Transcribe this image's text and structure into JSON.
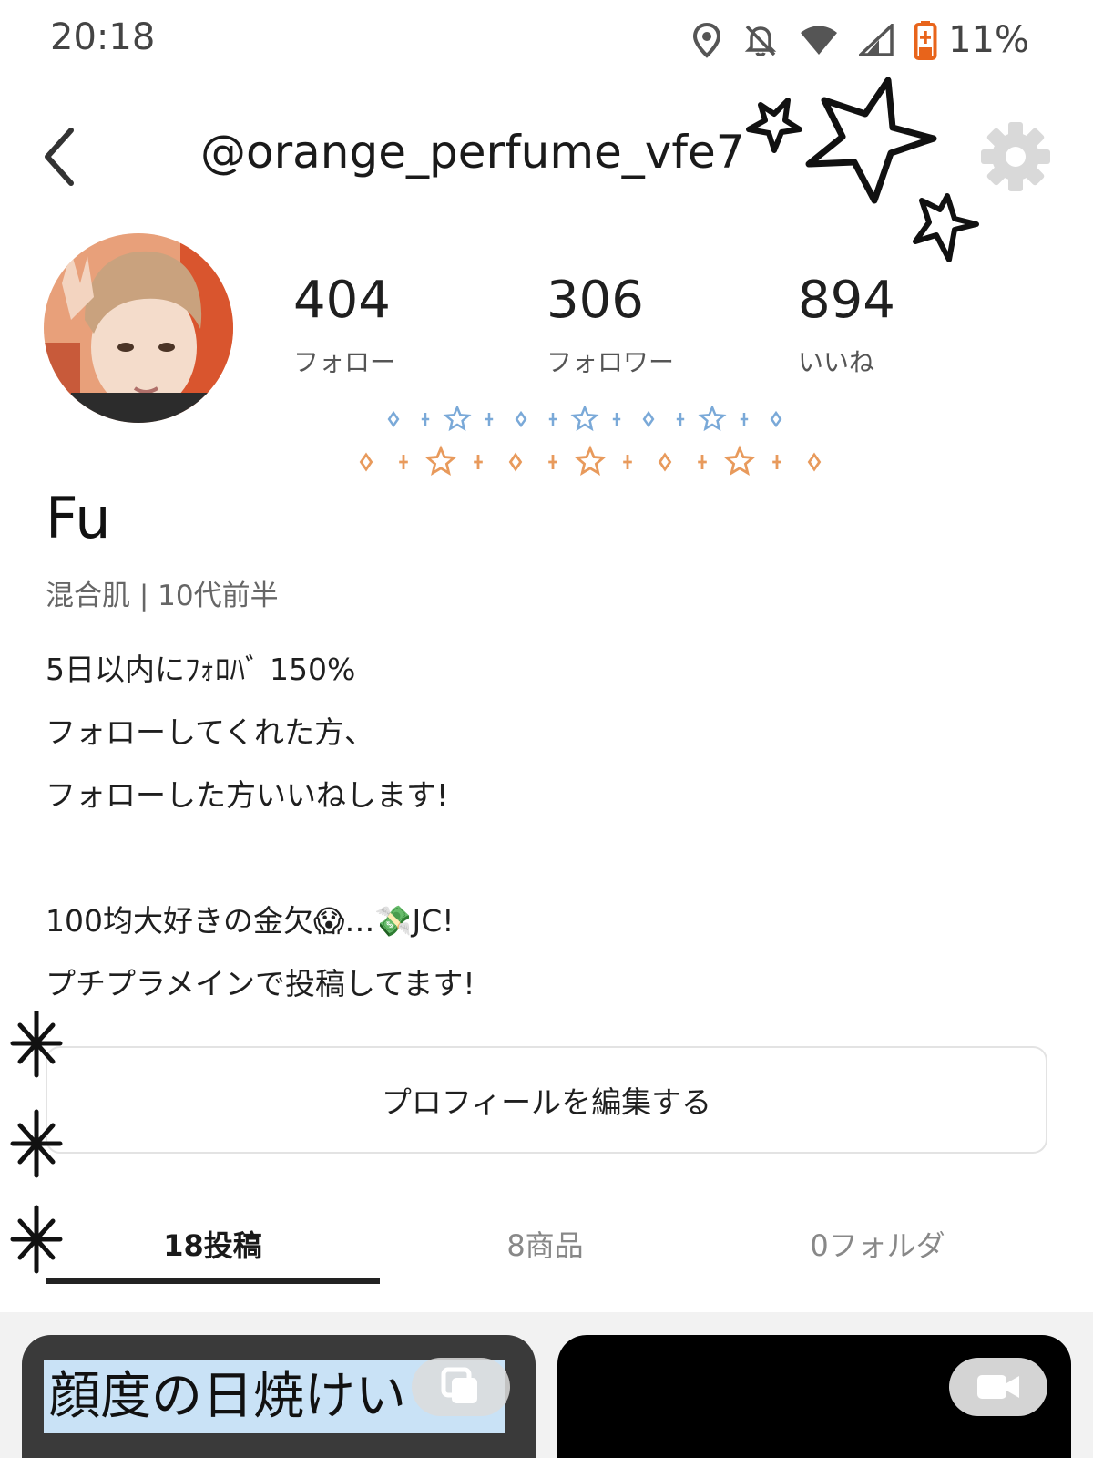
{
  "status_bar": {
    "time": "20:18",
    "battery": "11%",
    "icons": [
      "location-icon",
      "notifications-off-icon",
      "wifi-icon",
      "signal-icon",
      "battery-charging-icon"
    ],
    "battery_color": "#e8641b"
  },
  "header": {
    "username": "@orange_perfume_vfe7",
    "back_icon": "chevron-left-icon",
    "settings_icon": "gear-icon"
  },
  "stats": [
    {
      "value": "404",
      "label": "フォロー"
    },
    {
      "value": "306",
      "label": "フォロワー"
    },
    {
      "value": "894",
      "label": "いいね"
    }
  ],
  "profile": {
    "name": "Fu",
    "skin_info": "混合肌 | 10代前半",
    "bio_lines": [
      "5日以内にﾌｫﾛﾊﾞ 150%",
      "フォローしてくれた方、",
      "フォローした方いいねします!",
      "",
      "100均大好きの金欠😱…💸JC!",
      "プチプラメインで投稿してます!"
    ]
  },
  "edit_button": {
    "label": "プロフィールを編集する"
  },
  "tabs": [
    {
      "label": "18投稿",
      "active": true
    },
    {
      "label": "8商品",
      "active": false
    },
    {
      "label": "0フォルダ",
      "active": false
    }
  ],
  "posts": [
    {
      "caption": "顔度の日焼けい",
      "badge_icon": "multiple-images-icon"
    },
    {
      "caption": "",
      "badge_icon": "video-camera-icon"
    }
  ],
  "colors": {
    "deco_blue": "#7aa9d8",
    "deco_orange": "#e89a5c",
    "gear": "#d9d9d9"
  }
}
